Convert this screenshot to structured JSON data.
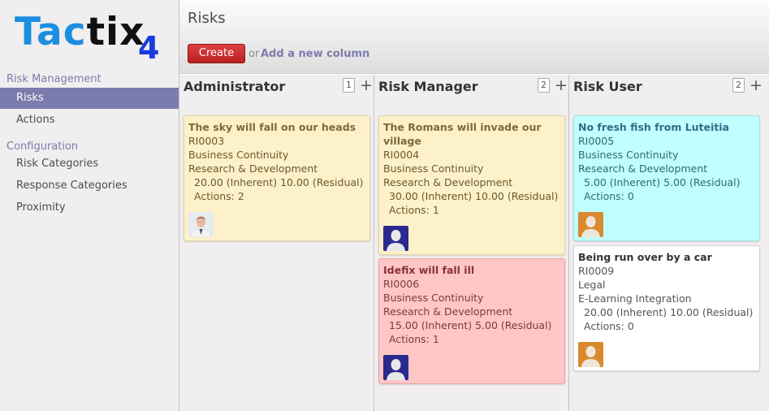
{
  "logo": {
    "part1": "Tac",
    "part2": "tix",
    "sub": "4"
  },
  "sidebar": {
    "section1": "Risk Management",
    "items1": [
      {
        "label": "Risks"
      },
      {
        "label": "Actions"
      }
    ],
    "section2": "Configuration",
    "items2": [
      {
        "label": "Risk Categories"
      },
      {
        "label": "Response Categories"
      },
      {
        "label": "Proximity"
      }
    ]
  },
  "header": {
    "title": "Risks",
    "create_label": "Create",
    "or_text": "or",
    "add_column_label": "Add a new column"
  },
  "columns": [
    {
      "title": "Administrator",
      "count": "1",
      "cards": [
        {
          "title": "The sky will fall on our heads",
          "ref": "RI0003",
          "category": "Business Continuity",
          "project": "Research & Development",
          "scores": "20.00 (Inherent) 10.00 (Residual)",
          "actions": "Actions: 2",
          "color": "yellow",
          "avatar": "photo"
        }
      ]
    },
    {
      "title": "Risk Manager",
      "count": "2",
      "cards": [
        {
          "title": "The Romans will invade our village",
          "ref": "RI0004",
          "category": "Business Continuity",
          "project": "Research & Development",
          "scores": "30.00 (Inherent) 10.00 (Residual)",
          "actions": "Actions: 1",
          "color": "yellow",
          "avatar": "blue"
        },
        {
          "title": "Idefix will fall ill",
          "ref": "RI0006",
          "category": "Business Continuity",
          "project": "Research & Development",
          "scores": "15.00 (Inherent) 5.00 (Residual)",
          "actions": "Actions: 1",
          "color": "red",
          "avatar": "blue"
        }
      ]
    },
    {
      "title": "Risk User",
      "count": "2",
      "cards": [
        {
          "title": "No fresh fish from Luteitia",
          "ref": "RI0005",
          "category": "Business Continuity",
          "project": "Research & Development",
          "scores": "5.00 (Inherent) 5.00 (Residual)",
          "actions": "Actions: 0",
          "color": "cyan",
          "avatar": "orange"
        },
        {
          "title": "Being run over by a car",
          "ref": "RI0009",
          "category": "Legal",
          "project": "E-Learning Integration",
          "scores": "20.00 (Inherent) 10.00 (Residual)",
          "actions": "Actions: 0",
          "color": "white",
          "avatar": "orange"
        }
      ]
    }
  ]
}
